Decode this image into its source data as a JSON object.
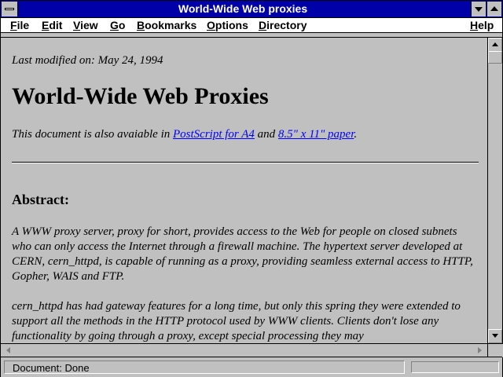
{
  "window": {
    "title": "World-Wide Web proxies"
  },
  "menu": {
    "items": [
      "File",
      "Edit",
      "View",
      "Go",
      "Bookmarks",
      "Options",
      "Directory"
    ],
    "help": "Help"
  },
  "document": {
    "last_modified": "Last modified on: May 24, 1994",
    "heading": "World-Wide Web Proxies",
    "avail_prefix": "This document is also avaiable in ",
    "link_a4": "PostScript for A4",
    "avail_and": " and ",
    "link_letter": "8.5\" x 11\" paper",
    "avail_suffix": ".",
    "abstract_heading": "Abstract:",
    "abstract_p1": "A WWW proxy server, proxy for short, provides access to the Web for people on closed subnets who can only access the Internet through a firewall machine. The hypertext server developed at CERN, cern_httpd, is capable of running as a proxy, providing seamless external access to HTTP, Gopher, WAIS and FTP.",
    "abstract_p2": "cern_httpd has had gateway features for a long time, but only this spring they were extended to support all the methods in the HTTP protocol used by WWW clients. Clients don't lose any functionality by going through a proxy, except special processing they may"
  },
  "status": {
    "text": "Document: Done"
  },
  "colors": {
    "titlebar": "#0000a8",
    "link": "#0000ff",
    "face": "#c0c0c0"
  },
  "icons": [
    "system-menu-icon",
    "minimize-icon",
    "maximize-icon",
    "scroll-up-icon",
    "scroll-down-icon",
    "scroll-left-icon",
    "scroll-right-icon"
  ]
}
